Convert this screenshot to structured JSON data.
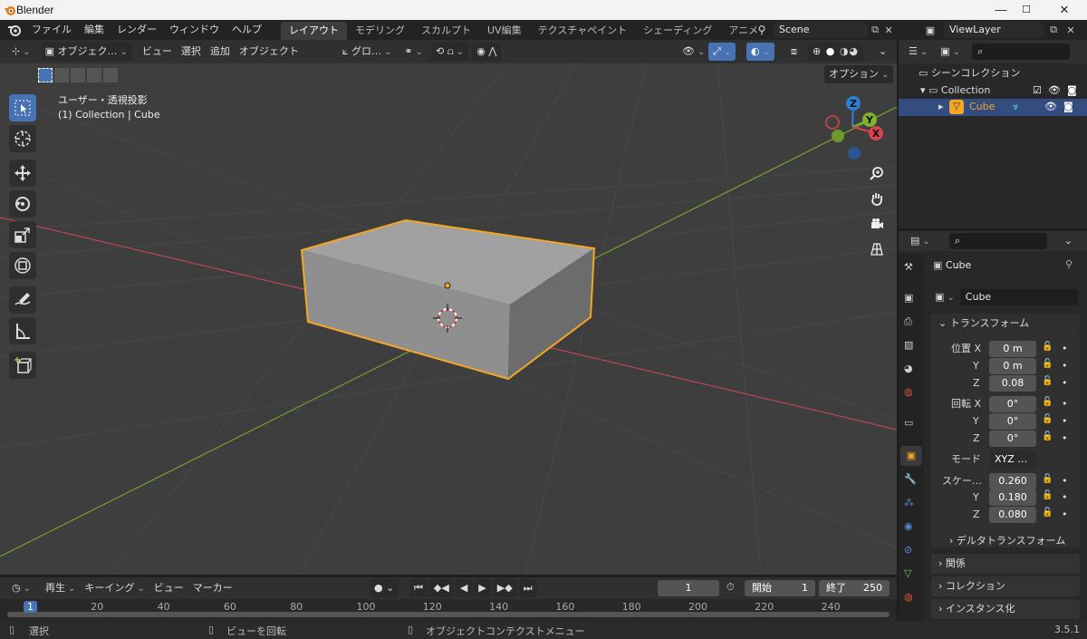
{
  "window": {
    "title": "Blender",
    "min": "—",
    "max": "☐",
    "close": "✕"
  },
  "menus": [
    "ファイル",
    "編集",
    "レンダー",
    "ウィンドウ",
    "ヘルプ"
  ],
  "workspace_tabs": [
    "レイアウト",
    "モデリング",
    "スカルプト",
    "UV編集",
    "テクスチャペイント",
    "シェーディング",
    "アニメーシ"
  ],
  "active_tab": "レイアウト",
  "scene": {
    "name": "Scene"
  },
  "view_layer": {
    "name": "ViewLayer"
  },
  "viewport": {
    "mode": "オブジェク…",
    "menus": [
      "ビュー",
      "選択",
      "追加",
      "オブジェクト"
    ],
    "orientation": "グロ…",
    "options_label": "オプション",
    "info_line1": "ユーザー・透視投影",
    "info_line2": "(1) Collection | Cube",
    "gizmo": {
      "z": "Z",
      "y": "Y",
      "x": "X"
    }
  },
  "outliner": {
    "scene_collection": "シーンコレクション",
    "collection": "Collection",
    "object": "Cube"
  },
  "properties": {
    "object_name": "Cube",
    "data_name": "Cube",
    "transform_title": "トランスフォーム",
    "location_label": "位置 X",
    "location": {
      "x": "0 m",
      "y": "0 m",
      "z": "0.08"
    },
    "rotation_label": "回転 X",
    "rotation": {
      "x": "0°",
      "y": "0°",
      "z": "0°"
    },
    "mode_label": "モード",
    "mode_value": "XYZ …",
    "scale_label": "スケー…",
    "scale": {
      "x": "0.260",
      "y": "0.180",
      "z": "0.080"
    },
    "axis_y": "Y",
    "axis_z": "Z",
    "delta_transform": "デルタトランスフォーム",
    "relations": "関係",
    "collections": "コレクション",
    "instancing": "インスタンス化"
  },
  "timeline": {
    "playback": "再生",
    "keying": "キーイング",
    "view": "ビュー",
    "marker": "マーカー",
    "current_frame": "1",
    "start_label": "開始",
    "start": "1",
    "end_label": "終了",
    "end": "250",
    "ruler": [
      "1",
      "20",
      "40",
      "60",
      "80",
      "100",
      "120",
      "140",
      "160",
      "180",
      "200",
      "220",
      "240"
    ]
  },
  "status": {
    "select": "選択",
    "rotate": "ビューを回転",
    "context": "オブジェクトコンテクストメニュー",
    "version": "3.5.1"
  },
  "colors": {
    "accent": "#4772b3",
    "selection": "#f5a623",
    "x_axis": "#d9434b",
    "y_axis": "#7fb12e",
    "z_axis": "#2f7ed8"
  }
}
